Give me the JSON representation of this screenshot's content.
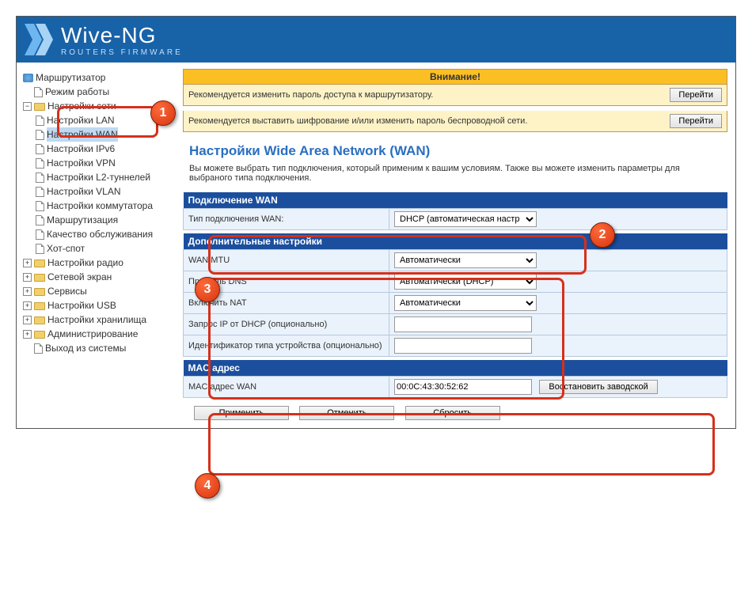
{
  "brand": {
    "title": "Wive-NG",
    "subtitle": "ROUTERS FIRMWARE"
  },
  "nav": {
    "router": "Маршрутизатор",
    "mode": "Режим работы",
    "net": "Настройки сети",
    "lan": "Настройки LAN",
    "wan": "Настройки WAN",
    "ipv6": "Настройки IPv6",
    "vpn": "Настройки VPN",
    "l2": "Настройки L2-туннелей",
    "vlan": "Настройки VLAN",
    "switch": "Настройки коммутатора",
    "routing": "Маршрутизация",
    "qos": "Качество обслуживания",
    "hotspot": "Хот-спот",
    "radio": "Настройки радио",
    "firewall": "Сетевой экран",
    "services": "Сервисы",
    "usb": "Настройки USB",
    "storage": "Настройки хранилища",
    "admin": "Администрирование",
    "logout": "Выход из системы"
  },
  "alerts": {
    "title": "Внимание!",
    "msg1": "Рекомендуется изменить пароль доступа к маршрутизатору.",
    "msg2": "Рекомендуется выставить шифрование и/или изменить пароль беспроводной сети.",
    "go": "Перейти"
  },
  "page": {
    "title": "Настройки Wide Area Network (WAN)",
    "desc": "Вы можете выбрать тип подключения, который применим к вашим условиям. Также вы можете изменить параметры для выбраного типа подключения."
  },
  "sections": {
    "conn": "Подключение WAN",
    "conn_type_label": "Тип подключения WAN:",
    "conn_type_value": "DHCP (автоматическая настр",
    "extra": "Дополнительные настройки",
    "mtu_label": "WAN MTU",
    "mtu_value": "Автоматически",
    "dns_label": "Профиль DNS",
    "dns_value": "Автоматически (DHCP)",
    "nat_label": "Включить NAT",
    "nat_value": "Автоматически",
    "dhcp_req_label": "Запрос IP от DHCP (опционально)",
    "dhcp_req_value": "",
    "devid_label": "Идентификатор типа устройства (опционально)",
    "devid_value": "",
    "mac": "MAC адрес",
    "mac_label": "MAC адрес WAN",
    "mac_value": "00:0C:43:30:52:62",
    "mac_restore": "Восстановить заводской"
  },
  "actions": {
    "apply": "Применить",
    "cancel": "Отменить",
    "reset": "Сбросить"
  },
  "callouts": {
    "c1": "1",
    "c2": "2",
    "c3": "3",
    "c4": "4"
  }
}
